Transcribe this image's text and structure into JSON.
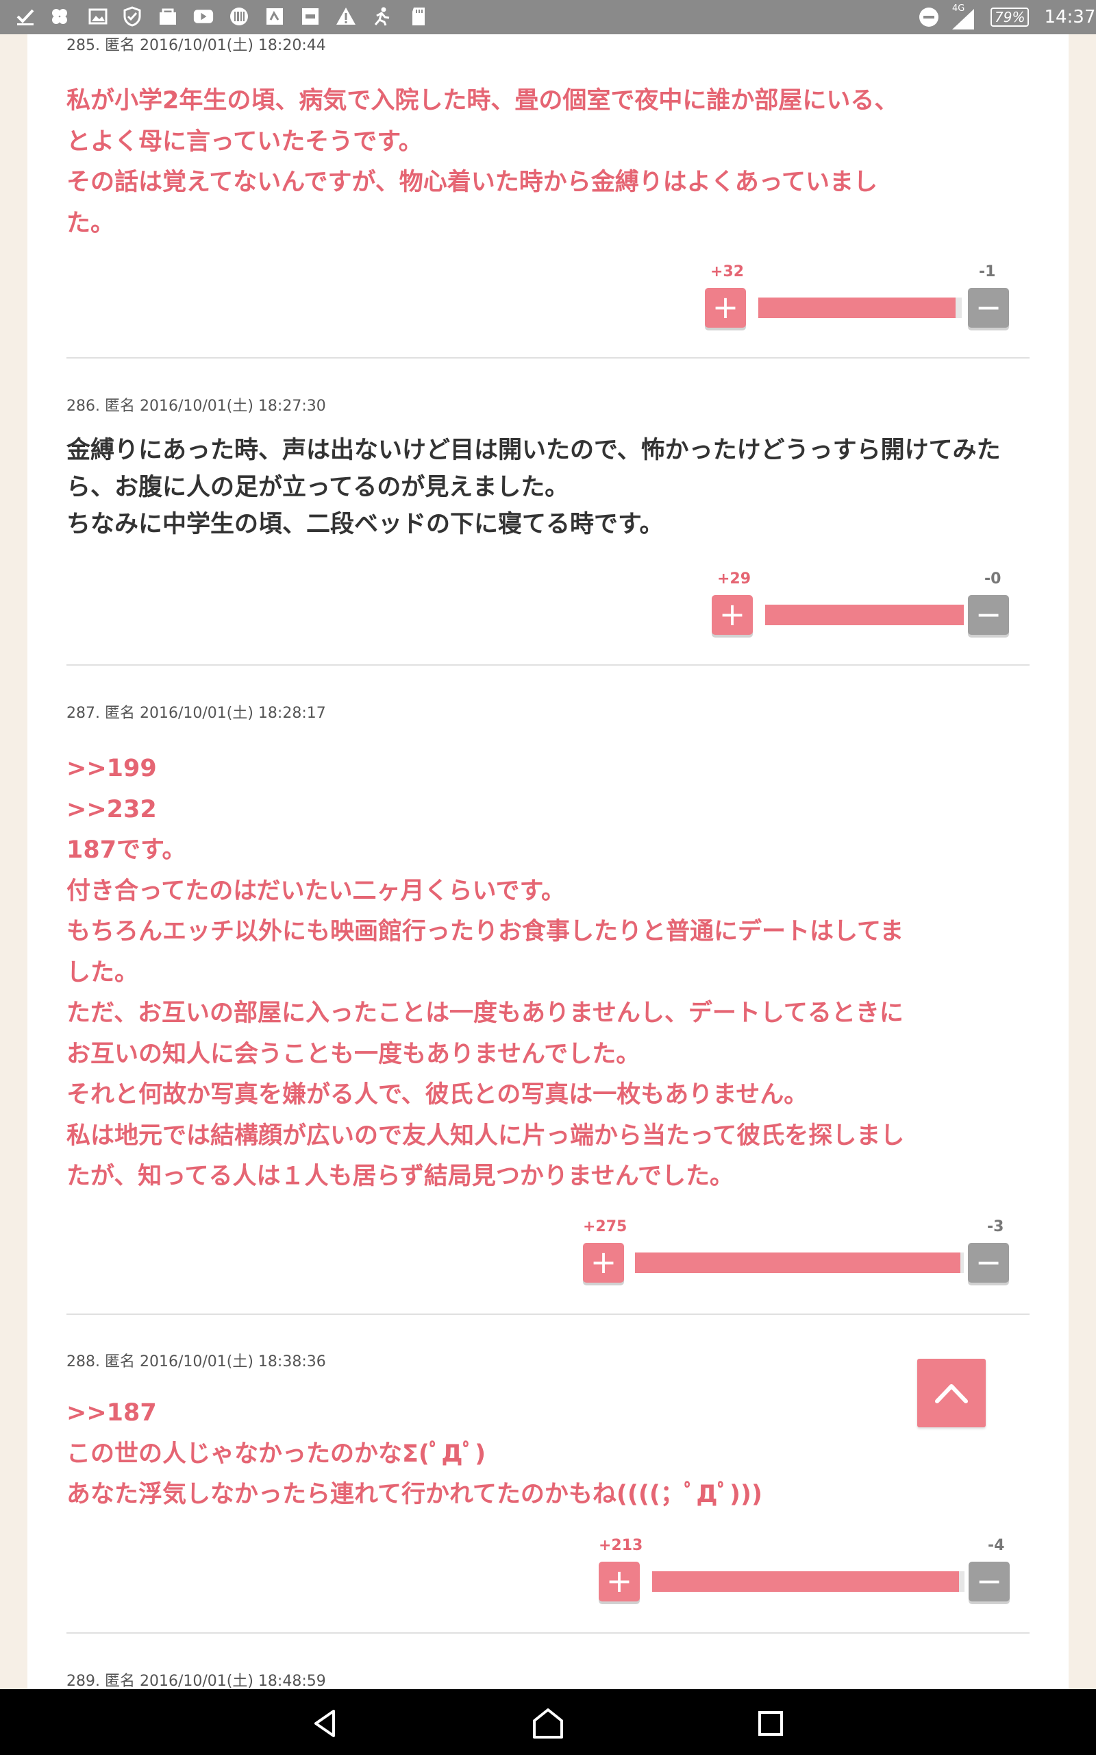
{
  "status_bar": {
    "left_icons": [
      "check-icon",
      "pinwheel-icon",
      "gallery-icon",
      "shield-icon",
      "shop-icon",
      "youtube-icon",
      "barcode-icon",
      "app-icon",
      "app2-icon",
      "warning-icon",
      "runner-icon",
      "sd-card-icon"
    ],
    "network": "4G",
    "battery": "79%",
    "time": "14:37"
  },
  "comments": [
    {
      "meta": "285. 匿名 2016/10/01(土) 18:20:44",
      "color": "#e56573",
      "lines": [
        "私が小学2年生の頃、病気で入院した時、畳の個室で夜中に誰か部屋にいる、",
        "とよく母に言っていたそうです。",
        "その話は覚えてないんですが、物心着いた時から金縛りはよくあっていまし",
        "た。"
      ],
      "plus": "+32",
      "minus": "-1",
      "approval": 0.97
    },
    {
      "meta": "286. 匿名 2016/10/01(土) 18:27:30",
      "color": "#333333",
      "lines": [
        "金縛りにあった時、声は出ないけど目は開いたので、怖かったけどうっすら開けてみた",
        "ら、お腹に人の足が立ってるのが見えました。",
        "ちなみに中学生の頃、二段ベッドの下に寝てる時です。"
      ],
      "plus": "+29",
      "minus": "-0",
      "approval": 1.0
    },
    {
      "meta": "287. 匿名 2016/10/01(土) 18:28:17",
      "color": "#e56573",
      "lines": [
        ">>199",
        ">>232",
        "187です。",
        "付き合ってたのはだいたい二ヶ月くらいです。",
        "もちろんエッチ以外にも映画館行ったりお食事したりと普通にデートはしてま",
        "した。",
        "ただ、お互いの部屋に入ったことは一度もありませんし、デートしてるときに",
        "お互いの知人に会うことも一度もありませんでした。",
        "それと何故か写真を嫌がる人で、彼氏との写真は一枚もありません。",
        "私は地元では結構顔が広いので友人知人に片っ端から当たって彼氏を探しまし",
        "たが、知ってる人は１人も居らず結局見つかりませんでした。"
      ],
      "plus": "+275",
      "minus": "-3",
      "approval": 0.989
    },
    {
      "meta": "288. 匿名 2016/10/01(土) 18:38:36",
      "color": "#e56573",
      "lines": [
        ">>187",
        "この世の人じゃなかったのかなΣ(ﾟДﾟ)",
        "あなた浮気しなかったら連れて行かれてたのかもね((((；ﾟДﾟ)))"
      ],
      "plus": "+213",
      "minus": "-4",
      "approval": 0.982
    },
    {
      "meta": "289. 匿名 2016/10/01(土) 18:48:59",
      "color": "#e56573",
      "lines": [],
      "plus": "",
      "minus": "",
      "approval": null
    }
  ],
  "scroll_top_icon": "chevron-up-icon",
  "nav_bar": {
    "icons": [
      "back-icon",
      "home-icon",
      "recents-icon"
    ]
  },
  "colors": {
    "accent": "#ef7f8a",
    "accent_text": "#e56573",
    "neutral_button": "#9e9e9e",
    "page_background": "#f6efe6"
  }
}
